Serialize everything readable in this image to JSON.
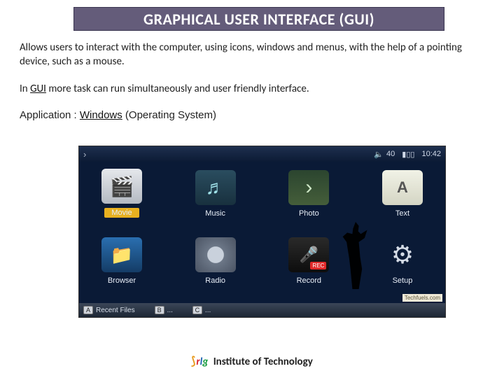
{
  "title": "GRAPHICAL USER INTERFACE (GUI)",
  "para1": "Allows users to interact with the computer, using icons, windows and menus, with the help of a pointing device, such as a mouse.",
  "para2_pre": "In ",
  "para2_u": "GUI",
  "para2_post": " more task can run simultaneously and user friendly interface.",
  "para3_pre": "Application : ",
  "para3_u": "Windows",
  "para3_post": " (Operating System)",
  "gui": {
    "topbar": {
      "volume": "40",
      "time": "10:42"
    },
    "row1": [
      {
        "label": "Movie",
        "name": "movie-icon",
        "cls": "movie-glyph"
      },
      {
        "label": "Music",
        "name": "music-icon",
        "cls": "music-glyph"
      },
      {
        "label": "Photo",
        "name": "photo-icon",
        "cls": "photo-glyph"
      },
      {
        "label": "Text",
        "name": "text-icon",
        "cls": "text-glyph"
      }
    ],
    "row2": [
      {
        "label": "Browser",
        "name": "browser-icon",
        "cls": "browser-glyph"
      },
      {
        "label": "Radio",
        "name": "radio-icon",
        "cls": "radio-glyph"
      },
      {
        "label": "Record",
        "name": "record-icon",
        "cls": "record-glyph"
      },
      {
        "label": "Setup",
        "name": "setup-icon",
        "cls": "setup-glyph"
      }
    ],
    "bottombar": [
      {
        "key": "A",
        "label": "Recent Files"
      },
      {
        "key": "B",
        "label": "..."
      },
      {
        "key": "C",
        "label": "..."
      }
    ],
    "watermark": "Techfuels.com"
  },
  "footer": {
    "logo": {
      "r": "r",
      "l": "l",
      "g": "g"
    },
    "text": "Institute of Technology"
  }
}
